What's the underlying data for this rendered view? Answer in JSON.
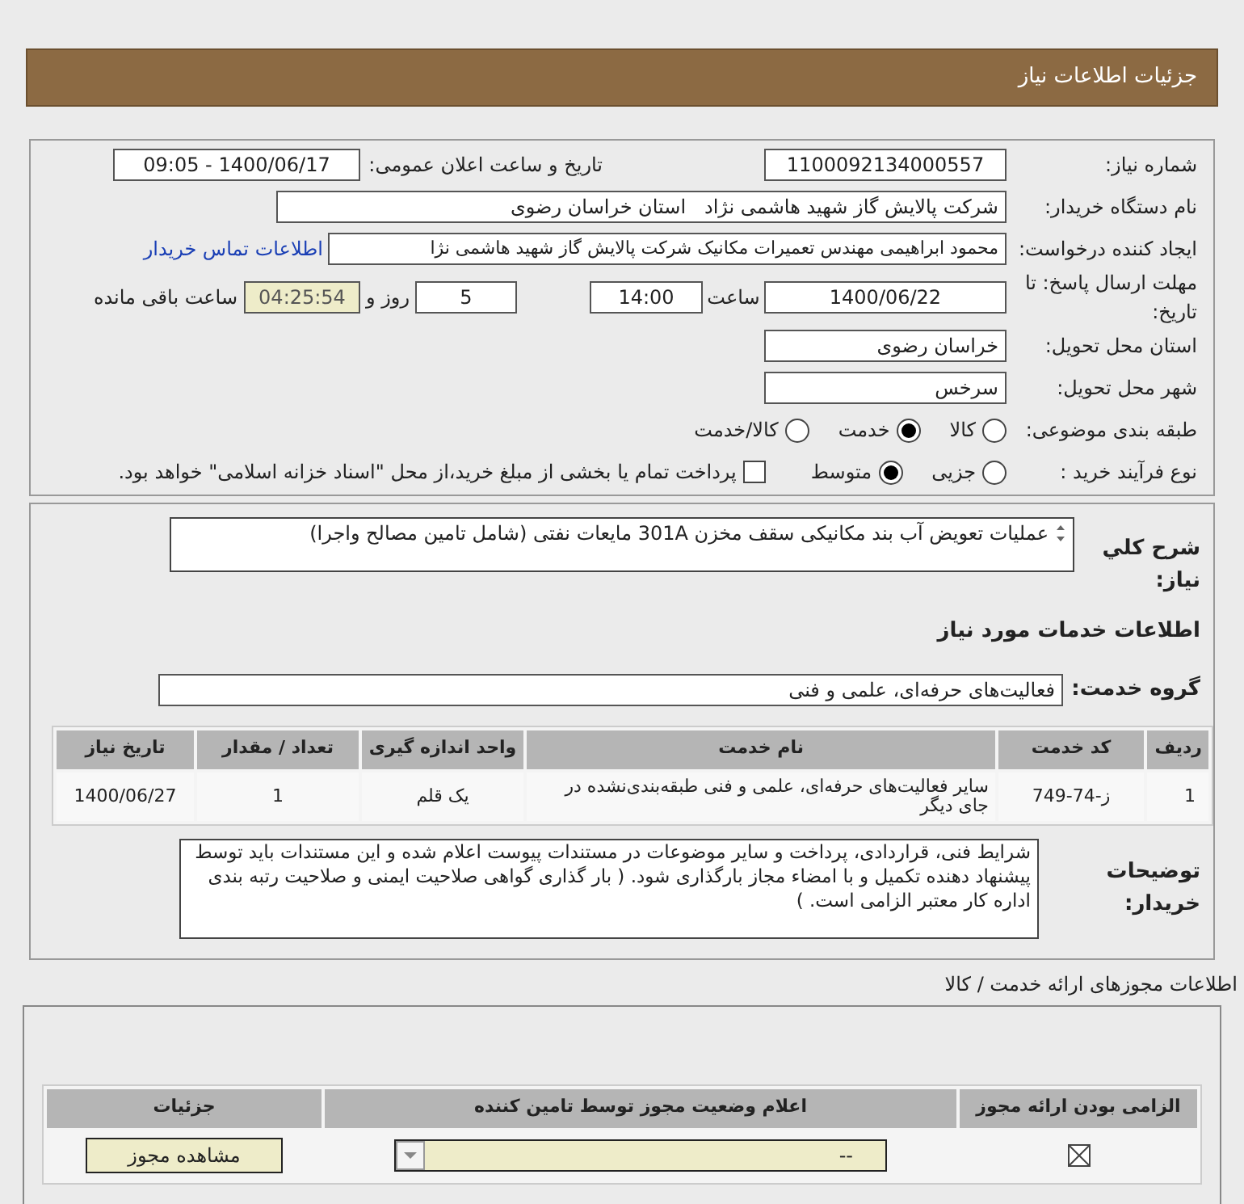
{
  "header": {
    "title": "جزئیات اطلاعات نیاز"
  },
  "need_number": {
    "label": "شماره نیاز:",
    "value": "1100092134000557"
  },
  "announce_datetime": {
    "label": "تاریخ و ساعت اعلان عمومی:",
    "value": "1400/06/17 - 09:05"
  },
  "buyer_org": {
    "label": "نام دستگاه خریدار:",
    "value": "شرکت پالایش گاز شهید هاشمی نژاد   استان خراسان رضوی"
  },
  "requester": {
    "label": "ایجاد کننده درخواست:",
    "value": "محمود ابراهیمی مهندس تعمیرات مکانیک شرکت پالایش گاز شهید هاشمی نژا",
    "link": "اطلاعات تماس خریدار"
  },
  "deadline": {
    "label": "مهلت ارسال پاسخ: تا تاریخ:",
    "date": "1400/06/22",
    "time_label": "ساعت",
    "time": "14:00",
    "days": "5",
    "days_label": "روز و",
    "remaining": "04:25:54",
    "remaining_label": "ساعت باقی مانده"
  },
  "delivery_province": {
    "label": "استان محل تحویل:",
    "value": "خراسان رضوی"
  },
  "delivery_city": {
    "label": "شهر محل تحویل:",
    "value": "سرخس"
  },
  "category": {
    "label": "طبقه بندی موضوعی:",
    "options": [
      {
        "label": "کالا",
        "selected": false
      },
      {
        "label": "خدمت",
        "selected": true
      },
      {
        "label": "کالا/خدمت",
        "selected": false
      }
    ]
  },
  "purchase_process": {
    "label": "نوع فرآیند خرید :",
    "options": [
      {
        "label": "جزیی",
        "selected": false
      },
      {
        "label": "متوسط",
        "selected": true
      }
    ],
    "payment": {
      "label": "پرداخت تمام یا بخشی از مبلغ خرید،از محل \"اسناد خزانه اسلامی\" خواهد بود.",
      "checked": false
    }
  },
  "summary": {
    "label": "شرح کلي نیاز:",
    "value": "عملیات تعویض آب بند مکانیکی سقف مخزن 301A مایعات نفتی (شامل تامین مصالح واجرا)"
  },
  "services_title": "اطلاعات خدمات مورد نیاز",
  "service_group": {
    "label": "گروه خدمت:",
    "value": "فعالیت‌های حرفه‌ای، علمی و فنی"
  },
  "services_table": {
    "columns": [
      "ردیف",
      "کد خدمت",
      "نام خدمت",
      "واحد اندازه گیری",
      "تعداد / مقدار",
      "تاریخ نیاز"
    ],
    "rows": [
      [
        "1",
        "ز-74-749",
        "سایر فعالیت‌های حرفه‌ای، علمی و فنی طبقه‌بندی‌نشده در جای دیگر",
        "یک قلم",
        "1",
        "1400/06/27"
      ]
    ]
  },
  "buyer_notes": {
    "label": "توضیحات خریدار:",
    "value": "شرایط فنی، قراردادی، پرداخت و سایر موضوعات در مستندات پیوست اعلام شده و این مستندات باید توسط پیشنهاد دهنده تکمیل و با امضاء مجاز بارگذاری شود. ( بار گذاری گواهی صلاحیت ایمنی و صلاحیت رتبه بندی اداره کار معتبر الزامی است. )"
  },
  "permits_title": "اطلاعات مجوزهای ارائه خدمت / کالا",
  "permits_table": {
    "columns": [
      "الزامی بودن ارائه مجوز",
      "اعلام وضعیت مجوز توسط تامین کننده",
      "جزئیات"
    ],
    "rows": [
      {
        "required": true,
        "status": "--",
        "action": "مشاهده مجوز"
      }
    ]
  }
}
